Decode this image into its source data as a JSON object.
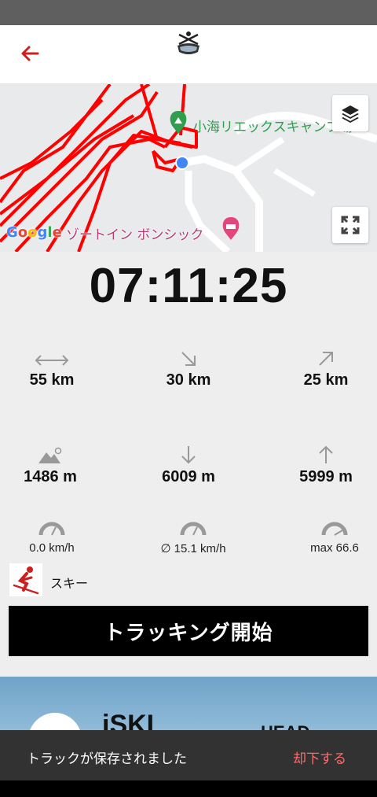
{
  "header": {
    "back_icon": "arrow-left-icon",
    "logo_icon": "skier-logo-icon",
    "accent": "#cc1f1f"
  },
  "map": {
    "poi_campsite": "小海リエックスキャンプ場",
    "poi_hotel": "ゾートイン ボンシック",
    "google_letters": [
      "G",
      "o",
      "o",
      "g",
      "l",
      "e"
    ],
    "layers_icon": "layers-icon",
    "fullscreen_icon": "fullscreen-icon",
    "track_color": "#ff0000"
  },
  "timer": "07:11:25",
  "stats": {
    "total_distance": "55 km",
    "downhill_distance": "30 km",
    "uphill_distance": "25 km",
    "altitude": "1486 m",
    "descent": "6009 m",
    "ascent": "5999 m",
    "current_speed": "0.0 km/h",
    "avg_speed": "∅ 15.1 km/h",
    "max_speed": "max 66.6"
  },
  "sport": {
    "label": "スキー",
    "icon": "ski-icon"
  },
  "track_button": "トラッキング開始",
  "banner": {
    "brand1": "iSKI",
    "brand2": "HEAD"
  },
  "snackbar": {
    "message": "トラックが保存されました",
    "action": "却下する"
  }
}
